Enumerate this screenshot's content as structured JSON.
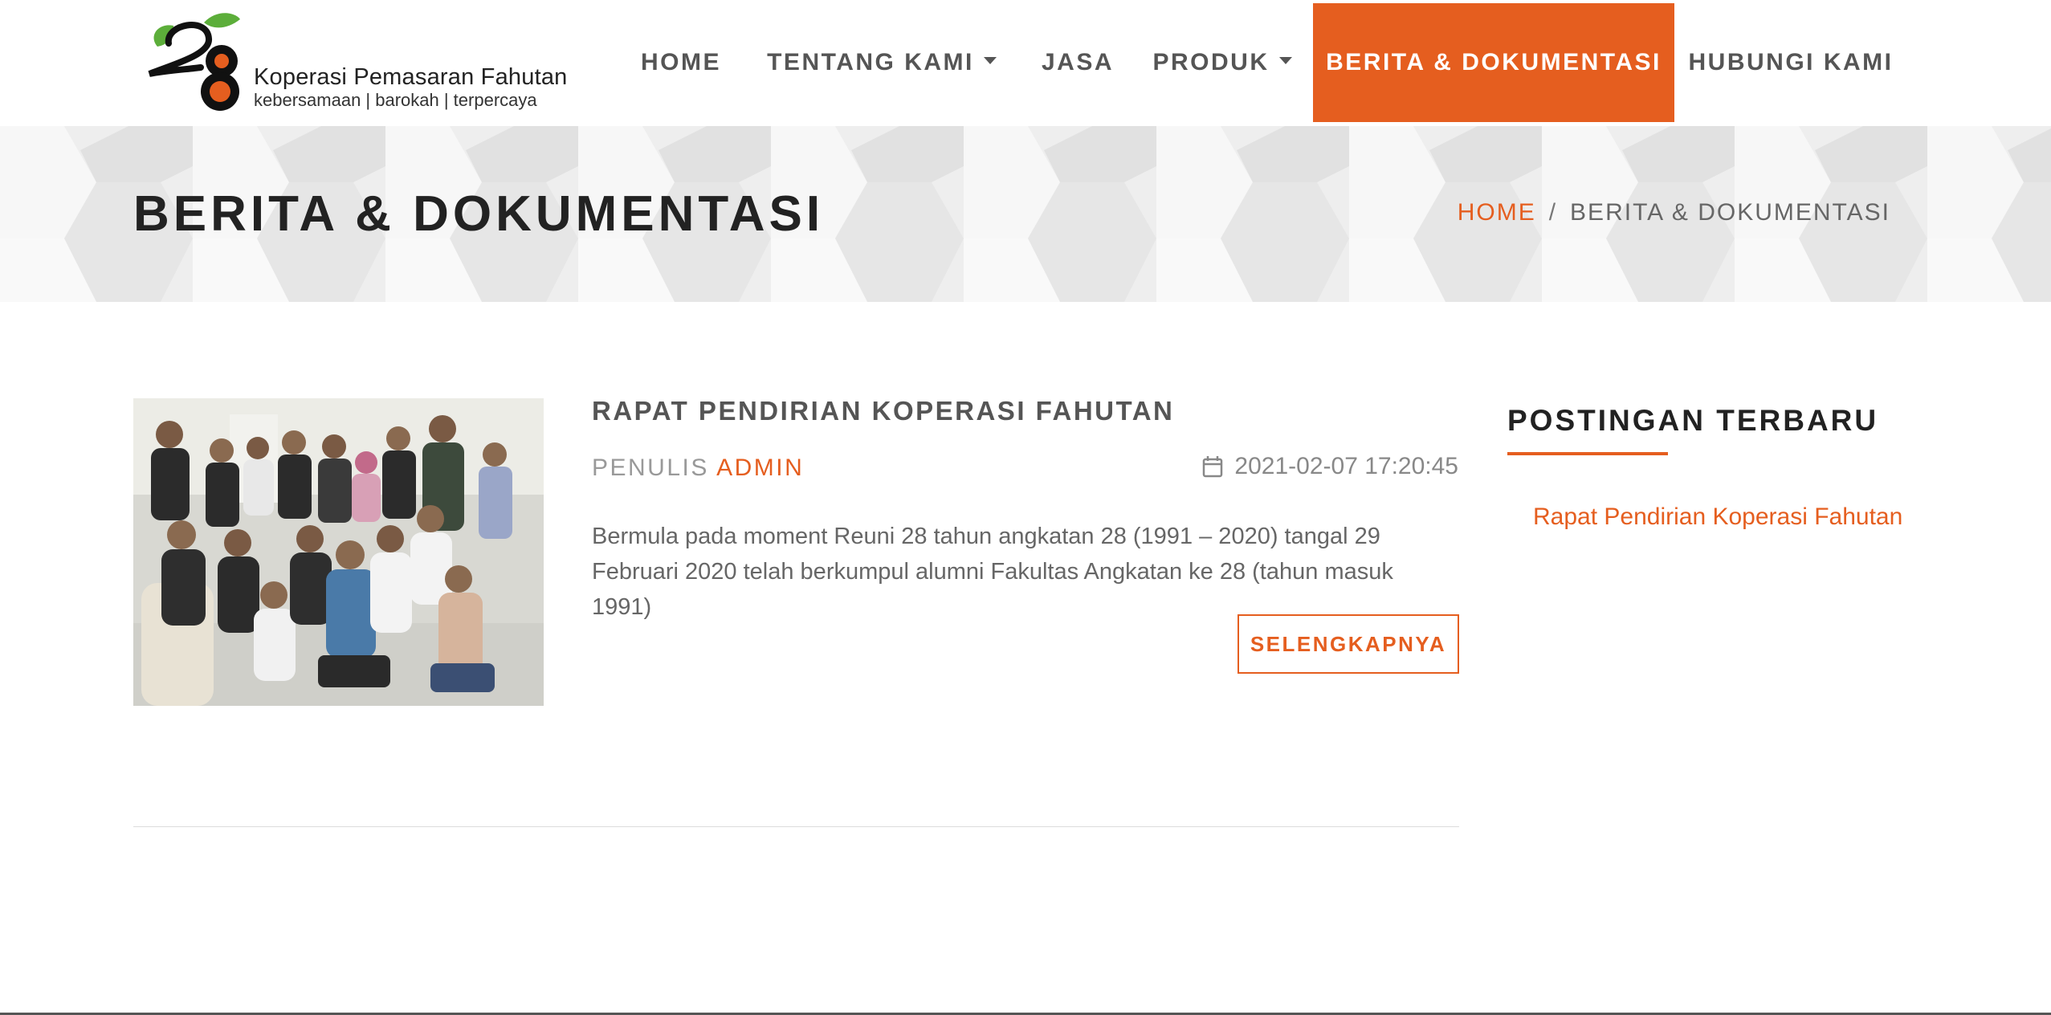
{
  "brand": {
    "logo_number": "28",
    "name": "Koperasi Pemasaran Fahutan",
    "tagline": "kebersamaan | barokah | terpercaya"
  },
  "nav": {
    "home": "HOME",
    "about": "TENTANG KAMI",
    "services": "JASA",
    "products": "PRODUK",
    "news": "BERITA & DOKUMENTASI",
    "contact": "HUBUNGI KAMI",
    "active": "news"
  },
  "banner": {
    "title": "BERITA & DOKUMENTASI",
    "breadcrumb": {
      "home": "HOME",
      "separator": "/",
      "current": "BERITA & DOKUMENTASI"
    }
  },
  "post": {
    "title": "RAPAT PENDIRIAN KOPERASI FAHUTAN",
    "author_label": "PENULIS",
    "author": "ADMIN",
    "date": "2021-02-07 17:20:45",
    "excerpt": "Bermula pada moment Reuni 28 tahun angkatan 28 (1991 – 2020) tangal 29 Februari 2020 telah berkumpul alumni Fakultas Angkatan ke 28 (tahun masuk 1991)",
    "read_more": "SELENGKAPNYA",
    "image_icon": "group-photo"
  },
  "sidebar": {
    "title": "POSTINGAN TERBARU",
    "links": [
      "Rapat Pendirian Koperasi Fahutan"
    ]
  },
  "colors": {
    "accent": "#e55e1f",
    "text": "#555555",
    "heading": "#222222",
    "banner_bg": "#ececec"
  }
}
